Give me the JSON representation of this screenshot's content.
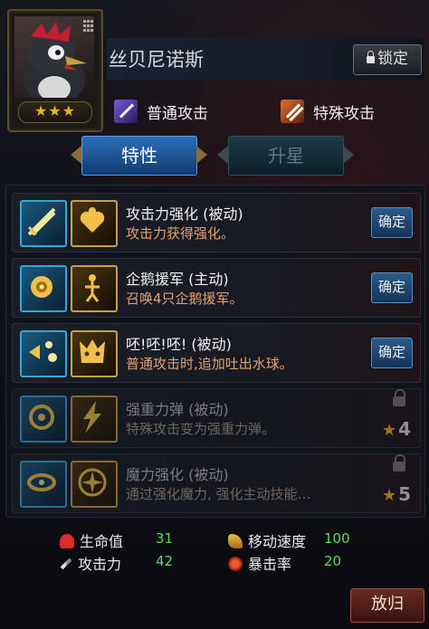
{
  "character": {
    "name": "丝贝尼诺斯",
    "stars": "★★★",
    "lock_label": "锁定"
  },
  "attacks": {
    "normal": "普通攻击",
    "special": "特殊攻击"
  },
  "tabs": {
    "traits": "特性",
    "star_up": "升星"
  },
  "skills": [
    {
      "name": "攻击力强化 (被动)",
      "desc": "攻击力获得强化。",
      "action": "确定",
      "locked": false
    },
    {
      "name": "企鹅援军 (主动)",
      "desc": "召唤4只企鹅援军。",
      "action": "确定",
      "locked": false
    },
    {
      "name": "呸!呸!呸! (被动)",
      "desc": "普通攻击时,追加吐出水球。",
      "action": "确定",
      "locked": false
    },
    {
      "name": "强重力弹 (被动)",
      "desc": "特殊攻击变为强重力弹。",
      "required_stars": "4",
      "locked": true
    },
    {
      "name": "魔力强化 (被动)",
      "desc": "通过强化魔力, 强化主动技能…",
      "required_stars": "5",
      "locked": true
    }
  ],
  "stats": {
    "hp_label": "生命值",
    "hp_value": "31",
    "atk_label": "攻击力",
    "atk_value": "42",
    "speed_label": "移动速度",
    "speed_value": "100",
    "crit_label": "暴击率",
    "crit_value": "20"
  },
  "dismiss_label": "放归",
  "colors": {
    "accent_blue": "#2c6fb8",
    "star_gold": "#f2b21c",
    "stat_green": "#5adc5a",
    "desc_orange": "#e4a070"
  }
}
